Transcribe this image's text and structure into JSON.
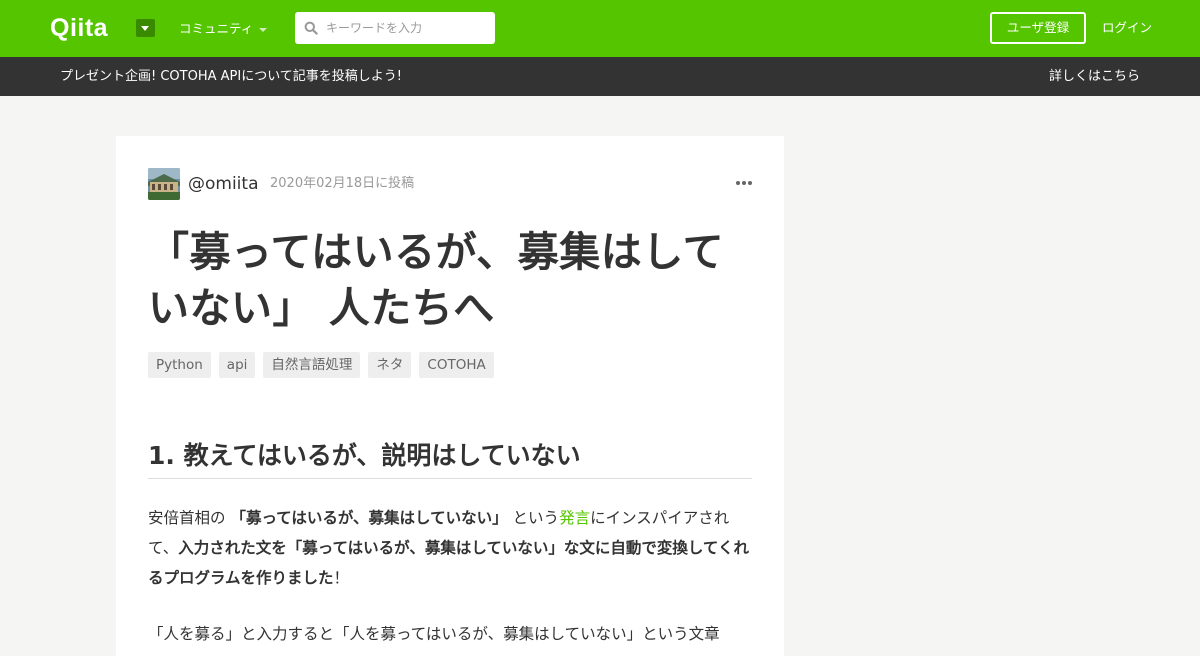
{
  "header": {
    "logo": "Qiita",
    "community_label": "コミュニティ",
    "search_placeholder": "キーワードを入力",
    "signup_label": "ユーザ登録",
    "login_label": "ログイン",
    "brand_color": "#55c500"
  },
  "announcement": {
    "text": "プレゼント企画! COTOHA APIについて記事を投稿しよう!",
    "link_label": "詳しくはこちら"
  },
  "article": {
    "author": "@omiita",
    "posted": "2020年02月18日に投稿",
    "title_line1": "「募ってはいるが、募集はして",
    "title_line2": "いない」 人たちへ",
    "tags": [
      "Python",
      "api",
      "自然言語処理",
      "ネタ",
      "COTOHA"
    ],
    "section_heading": "1. 教えてはいるが、説明はしていない",
    "paragraph": {
      "p1": "安倍首相の",
      "p2": "「募ってはいるが、募集はしていない」",
      "p3": "という",
      "link": "発言",
      "p4": "にインスパイアされて、",
      "p5": "入力された文を「募ってはいるが、募集はしていない」な文に自動で変換してくれるプログラムを作りました",
      "p6": "！"
    },
    "paragraph2": "「人を募る」と入力すると「人を募ってはいるが、募集はしていない」という文章"
  }
}
